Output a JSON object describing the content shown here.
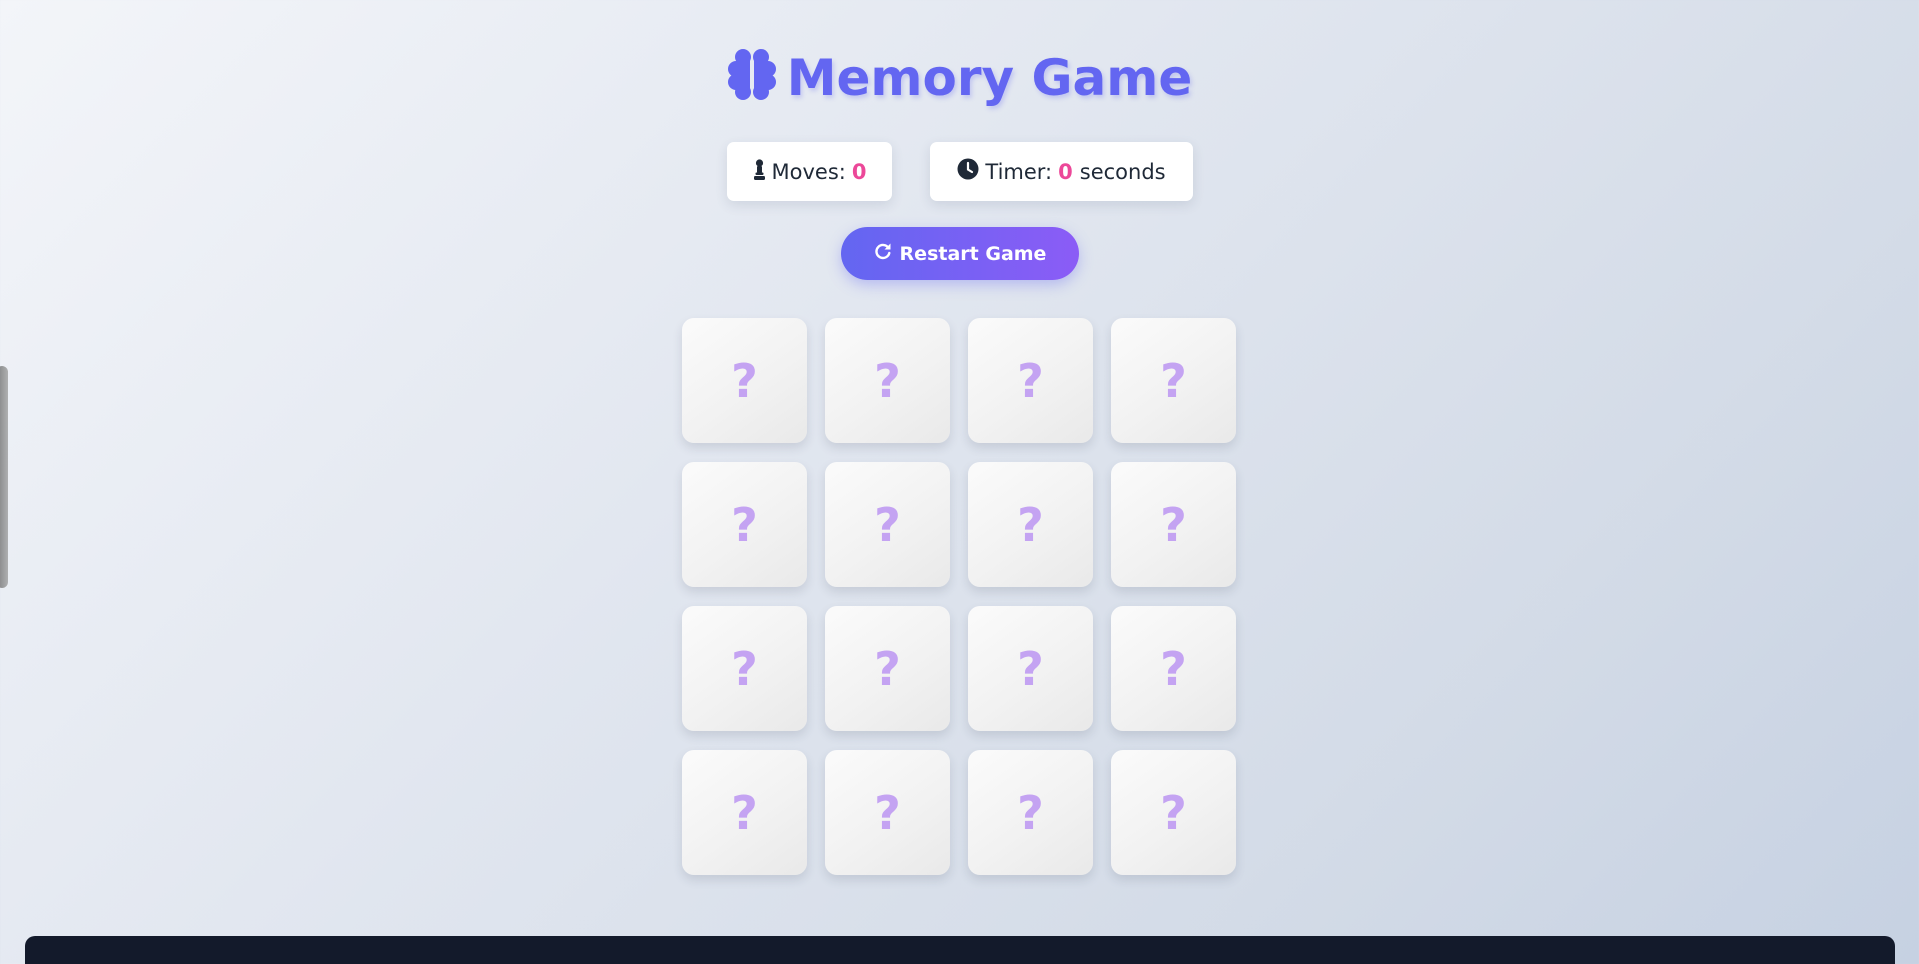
{
  "header": {
    "title": "Memory Game",
    "title_icon": "brain-icon"
  },
  "stats": {
    "moves_label": "Moves:",
    "moves_value": "0",
    "moves_icon": "chess-pawn-icon",
    "timer_label": "Timer:",
    "timer_value": "0",
    "timer_unit": "seconds",
    "timer_icon": "clock-icon"
  },
  "controls": {
    "restart_label": "Restart Game",
    "restart_icon": "redo-icon"
  },
  "board": {
    "rows": 4,
    "columns": 4,
    "cards": [
      "?",
      "?",
      "?",
      "?",
      "?",
      "?",
      "?",
      "?",
      "?",
      "?",
      "?",
      "?",
      "?",
      "?",
      "?",
      "?"
    ]
  },
  "colors": {
    "accent": "#6366f1",
    "accent_end": "#8b5cf6",
    "highlight": "#ec4899",
    "card_symbol": "#c4a3f2",
    "footer": "#131a2b"
  }
}
